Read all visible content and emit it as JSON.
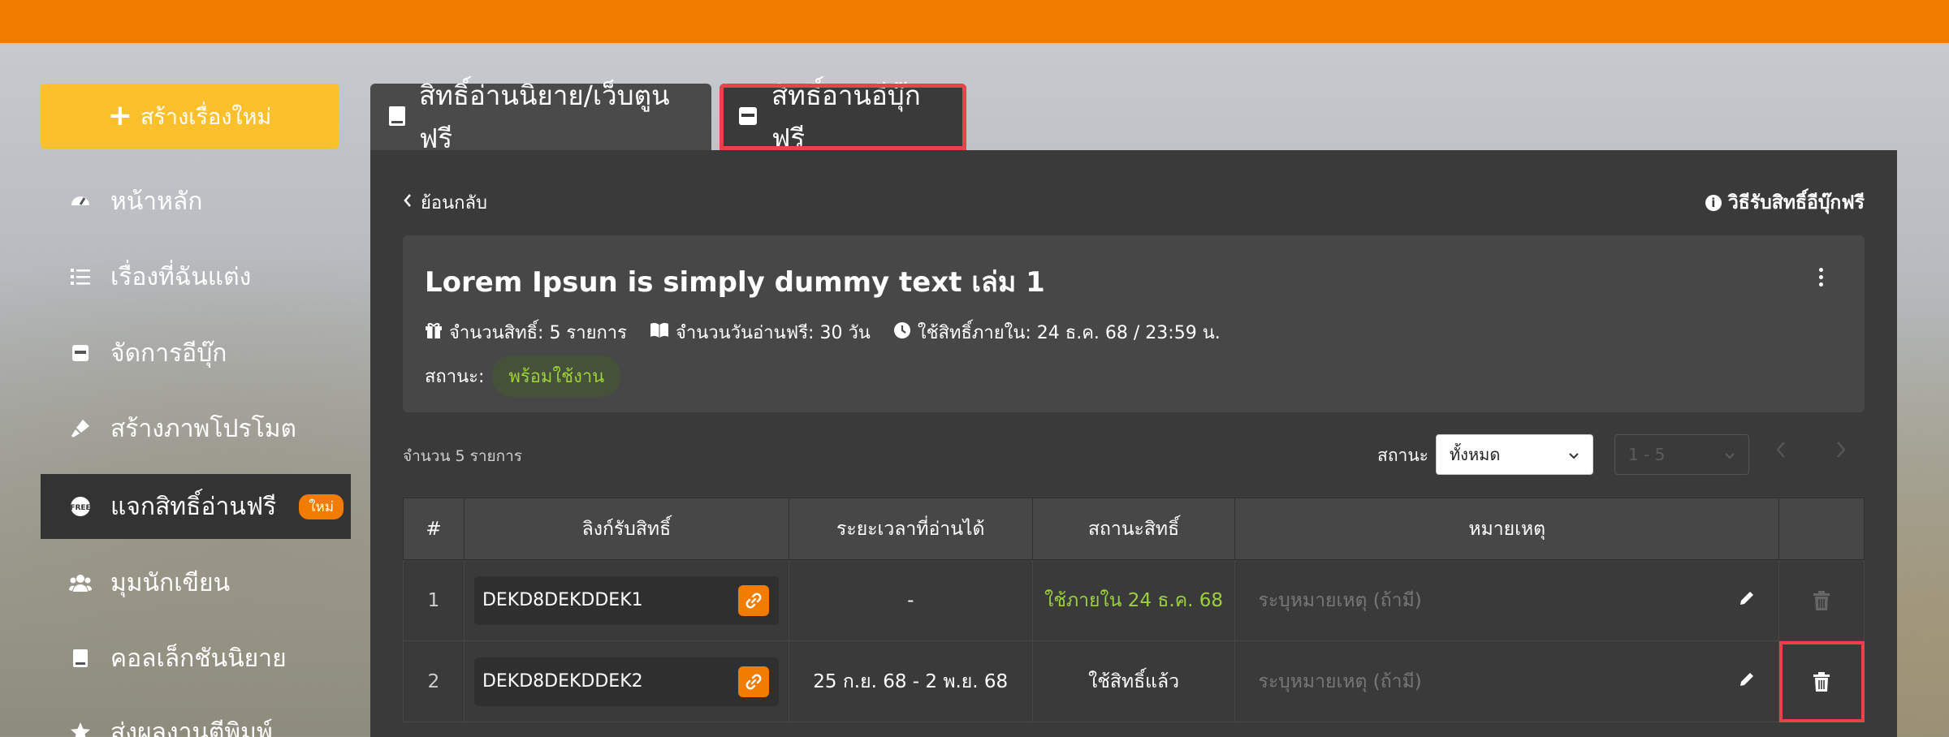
{
  "colors": {
    "accent": "#f27c00",
    "create_button": "#fcc02c",
    "highlight_outline": "#e8424a",
    "status_green": "#9bd13a"
  },
  "sidebar": {
    "create_label": "สร้างเรื่องใหม่",
    "items": [
      {
        "label": "หน้าหลัก",
        "icon": "dashboard-icon"
      },
      {
        "label": "เรื่องที่ฉันแต่ง",
        "icon": "list-icon"
      },
      {
        "label": "จัดการอีบุ๊ก",
        "icon": "ebook-icon"
      },
      {
        "label": "สร้างภาพโปรโมต",
        "icon": "brush-icon"
      },
      {
        "label": "แจกสิทธิ์อ่านฟรี",
        "icon": "free-badge-icon",
        "badge": "ใหม่"
      },
      {
        "label": "มุมนักเขียน",
        "icon": "users-icon"
      },
      {
        "label": "คอลเล็กชันนิยาย",
        "icon": "book-icon"
      },
      {
        "label": "ส่งผลงานตีพิมพ์",
        "icon": "star-icon"
      }
    ]
  },
  "tabs": [
    {
      "label": "สิทธิ์อ่านนิยาย/เว็บตูนฟรี",
      "icon": "book-icon"
    },
    {
      "label": "สิทธิ์อ่านอีบุ๊กฟรี",
      "icon": "ebook-icon"
    }
  ],
  "panel": {
    "back_label": "ย้อนกลับ",
    "howto_label": "วิธีรับสิทธิ์อีบุ๊กฟรี",
    "card": {
      "title": "Lorem Ipsun is simply dummy text เล่ม 1",
      "meta": [
        {
          "icon": "gift-icon",
          "text": "จำนวนสิทธิ์: 5 รายการ"
        },
        {
          "icon": "open-book-icon",
          "text": "จำนวนวันอ่านฟรี: 30 วัน"
        },
        {
          "icon": "clock-icon",
          "text": "ใช้สิทธิ์ภายใน: 24 ธ.ค. 68 / 23:59 น."
        }
      ],
      "status_label": "สถานะ:",
      "status_value": "พร้อมใช้งาน"
    },
    "count_text": "จำนวน 5 รายการ",
    "filter": {
      "label": "สถานะ",
      "selected": "ทั้งหมด",
      "pager": "1 - 5"
    },
    "table": {
      "headers": [
        "#",
        "ลิงก์รับสิทธิ์",
        "ระยะเวลาที่อ่านได้",
        "สถานะสิทธิ์",
        "หมายเหตุ",
        ""
      ],
      "note_placeholder": "ระบุหมายเหตุ (ถ้ามี)",
      "rows": [
        {
          "num": "1",
          "code": "DEKD8DEKDDEK1",
          "period": "-",
          "status": "ใช้ภายใน 24 ธ.ค. 68",
          "status_color": "green"
        },
        {
          "num": "2",
          "code": "DEKD8DEKDDEK2",
          "period": "25 ก.ย. 68 - 2 พ.ย. 68",
          "status": "ใช้สิทธิ์แล้ว",
          "status_color": "white"
        }
      ]
    }
  }
}
